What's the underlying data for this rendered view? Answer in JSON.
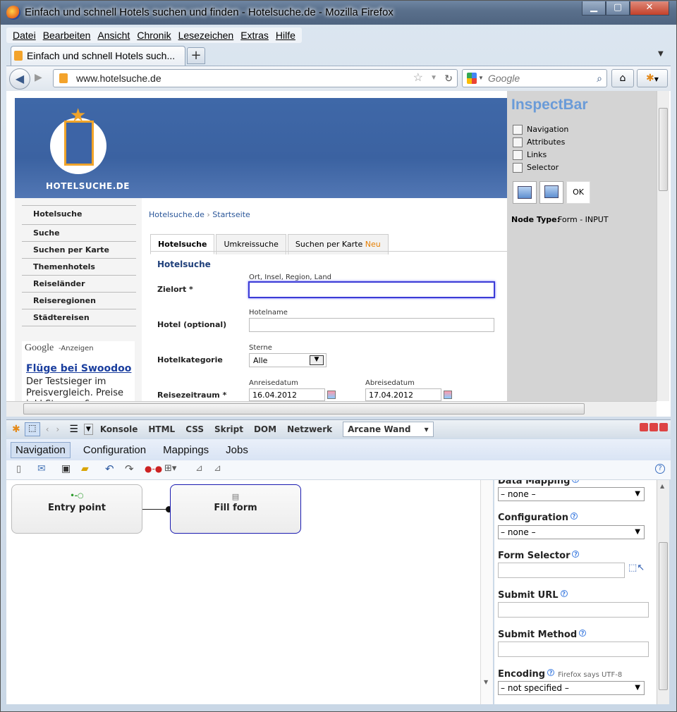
{
  "window": {
    "title": "Einfach und schnell Hotels suchen und finden - Hotelsuche.de - Mozilla Firefox"
  },
  "menu": [
    "Datei",
    "Bearbeiten",
    "Ansicht",
    "Chronik",
    "Lesezeichen",
    "Extras",
    "Hilfe"
  ],
  "tab": {
    "label": "Einfach und schnell Hotels such..."
  },
  "url": "www.hotelsuche.de",
  "search": {
    "placeholder": "Google"
  },
  "site": {
    "logo_text": "HOTELSUCHE.DE",
    "nav": [
      "Hotelsuche",
      "Suche",
      "Suchen per Karte",
      "Themenhotels",
      "Reiseländer",
      "Reiseregionen",
      "Städtereisen"
    ],
    "ads_label": "Google",
    "ads_suffix": "-Anzeigen",
    "ad_title": "Flüge bei Swoodoo",
    "ad_text": "Der Testsieger im Preisvergleich. Preise inkl.Steuern &",
    "breadcrumb": [
      "Hotelsuche.de",
      "Startseite"
    ],
    "tabs": [
      "Hotelsuche",
      "Umkreissuche",
      "Suchen per Karte"
    ],
    "tab_new": "Neu",
    "form_title": "Hotelsuche",
    "zielort_label": "Zielort *",
    "zielort_hint": "Ort, Insel, Region, Land",
    "hotel_label": "Hotel (optional)",
    "hotel_hint": "Hotelname",
    "kategorie_label": "Hotelkategorie",
    "kategorie_hint": "Sterne",
    "kategorie_value": "Alle",
    "reise_label": "Reisezeitraum *",
    "anreise_hint": "Anreisedatum",
    "anreise_value": "16.04.2012",
    "abreise_hint": "Abreisedatum",
    "abreise_value": "17.04.2012"
  },
  "inspect": {
    "title": "InspectBar",
    "options": [
      "Navigation",
      "Attributes",
      "Links",
      "Selector"
    ],
    "ok": "OK",
    "node_type_label": "Node Type:",
    "node_type_value": "Form - INPUT"
  },
  "devtools": {
    "tabs": [
      "Konsole",
      "HTML",
      "CSS",
      "Skript",
      "DOM",
      "Netzwerk"
    ],
    "active": "Arcane Wand"
  },
  "aw": {
    "menu": [
      "Navigation",
      "Configuration",
      "Mappings",
      "Jobs"
    ],
    "nodes": {
      "entry": "Entry point",
      "fill": "Fill form"
    },
    "props": {
      "data_mapping": "Data Mapping",
      "data_mapping_val": "– none –",
      "configuration": "Configuration",
      "configuration_val": "– none –",
      "form_selector": "Form Selector",
      "submit_url": "Submit URL",
      "submit_method": "Submit Method",
      "encoding": "Encoding",
      "encoding_note": "Firefox says UTF-8",
      "encoding_val": "– not specified –"
    }
  }
}
